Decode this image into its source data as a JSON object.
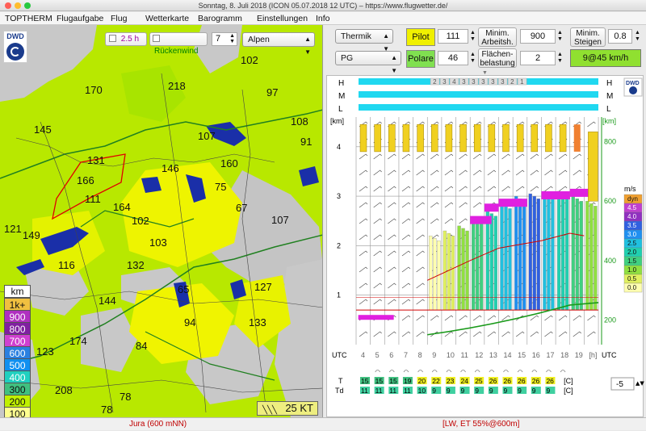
{
  "window_title": "Sonntag, 8. Juli 2018 (ICON 05.07.2018 12 UTC) – https://www.flugwetter.de/",
  "menu": [
    "TOPTHERM",
    "Flugaufgabe",
    "Flug",
    "Wetterkarte",
    "Barogramm",
    "Einstellungen",
    "Info"
  ],
  "map": {
    "logo_text": "DWD",
    "checkbox_25h": "2.5 h",
    "checkbox_rueckenwind": "Rückenwind",
    "stepper_value": "7",
    "region_select": "Alpen",
    "labels": [
      {
        "t": "102"
      },
      {
        "t": "170"
      },
      {
        "t": "218"
      },
      {
        "t": "97"
      },
      {
        "t": "145"
      },
      {
        "t": "108"
      },
      {
        "t": "107"
      },
      {
        "t": "91"
      },
      {
        "t": "131"
      },
      {
        "t": "160"
      },
      {
        "t": "146"
      },
      {
        "t": "166"
      },
      {
        "t": "75"
      },
      {
        "t": "111"
      },
      {
        "t": "164"
      },
      {
        "t": "67"
      },
      {
        "t": "102"
      },
      {
        "t": "107"
      },
      {
        "t": "121"
      },
      {
        "t": "149"
      },
      {
        "t": "103"
      },
      {
        "t": "116"
      },
      {
        "t": "132"
      },
      {
        "t": "65"
      },
      {
        "t": "127"
      },
      {
        "t": "144"
      },
      {
        "t": "94"
      },
      {
        "t": "133"
      },
      {
        "t": "174"
      },
      {
        "t": "123"
      },
      {
        "t": "84"
      },
      {
        "t": "208"
      },
      {
        "t": "78"
      },
      {
        "t": "78"
      }
    ],
    "legend_title": "km",
    "legend": [
      {
        "label": "1k+",
        "color": "#f0c040"
      },
      {
        "label": "900",
        "color": "#b030c0"
      },
      {
        "label": "800",
        "color": "#8020a0"
      },
      {
        "label": "700",
        "color": "#d040d0"
      },
      {
        "label": "600",
        "color": "#2a80e0"
      },
      {
        "label": "500",
        "color": "#1090f0"
      },
      {
        "label": "400",
        "color": "#20d0c0"
      },
      {
        "label": "300",
        "color": "#40c080"
      },
      {
        "label": "200",
        "color": "#c0f000"
      },
      {
        "label": "100",
        "color": "#ffff90"
      }
    ],
    "wind_scale": "25 KT"
  },
  "controls": {
    "thermik_select": "Thermik",
    "pg_select": "PG",
    "pilot_label": "Pilot",
    "pilot_value": "111",
    "polare_label": "Polare",
    "polare_value": "46",
    "min_arbeitsh_label": "Minim. Arbeitsh.",
    "min_arbeitsh_value": "900",
    "min_steigen_label": "Minim. Steigen",
    "min_steigen_value": "0.8",
    "flaechenbelastung_label": "Flächen-belastung",
    "flaechenbelastung_value": "2",
    "result": "9@45 km/h"
  },
  "sounding": {
    "rows": [
      "H",
      "M",
      "L"
    ],
    "cloud_digits_h": [
      "2",
      "3",
      "4",
      "3",
      "3",
      "3",
      "3",
      "3",
      "2",
      "1"
    ],
    "left_axis_title": "[km]",
    "right_axis_title": "[km]",
    "left_axis_ticks": [
      "4",
      "3",
      "2",
      "1"
    ],
    "right_axis_ticks": [
      "800",
      "600",
      "400",
      "200"
    ],
    "hours": [
      "4",
      "5",
      "6",
      "7",
      "8",
      "9",
      "10",
      "11",
      "12",
      "13",
      "14",
      "15",
      "16",
      "17",
      "18",
      "19",
      "[h]"
    ],
    "utc_left": "UTC",
    "utc_right": "UTC",
    "ms_title": "m/s",
    "ms_scale": [
      {
        "label": "dyn",
        "color": "#f0a030"
      },
      {
        "label": "4.5",
        "color": "#c040d0"
      },
      {
        "label": "4.0",
        "color": "#9030c0"
      },
      {
        "label": "3.5",
        "color": "#3060e0"
      },
      {
        "label": "3.0",
        "color": "#2090f0"
      },
      {
        "label": "2.5",
        "color": "#20c0e0"
      },
      {
        "label": "2.0",
        "color": "#20d0b0"
      },
      {
        "label": "1.5",
        "color": "#40d080"
      },
      {
        "label": "1.0",
        "color": "#90e040"
      },
      {
        "label": "0.5",
        "color": "#e0f060"
      },
      {
        "label": "0.0",
        "color": "#ffffb0"
      }
    ],
    "temp_label": "T",
    "td_label": "Td",
    "temps": [
      "15",
      "15",
      "15",
      "19",
      "20",
      "22",
      "23",
      "24",
      "25",
      "26",
      "26",
      "26",
      "26",
      "26"
    ],
    "dewpoints": [
      "11",
      "11",
      "11",
      "11",
      "10",
      "9",
      "9",
      "9",
      "9",
      "9",
      "9",
      "9",
      "9",
      "9"
    ],
    "unit": "[C]",
    "offset_value": "-5"
  },
  "status": {
    "left": "Jura (600 mNN)",
    "right": "[LW, ET  55%@600m]"
  }
}
